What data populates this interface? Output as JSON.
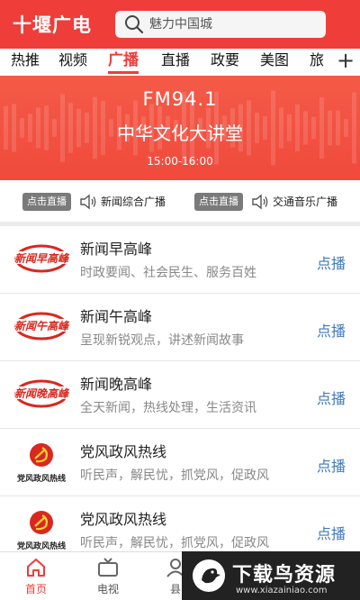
{
  "header": {
    "title": "十堰广电",
    "search_placeholder": "魅力中国城"
  },
  "nav": {
    "tabs": [
      "热推",
      "视频",
      "广播",
      "直播",
      "政要",
      "美图",
      "旅"
    ],
    "active": "广播",
    "plus": "+"
  },
  "banner": {
    "frequency": "FM94.1",
    "program": "中华文化大讲堂",
    "time": "15:00-16:00"
  },
  "live": [
    {
      "button": "点击直播",
      "station": "新闻综合广播"
    },
    {
      "button": "点击直播",
      "station": "交通音乐广播"
    }
  ],
  "programs": [
    {
      "logo": "news-peak",
      "logo_text": "新闻早高峰",
      "title": "新闻早高峰",
      "desc": "时政要闻、社会民生、服务百姓",
      "action": "点播"
    },
    {
      "logo": "news-peak",
      "logo_text": "新闻午高峰",
      "title": "新闻午高峰",
      "desc": "呈现新锐观点，讲述新闻故事",
      "action": "点播"
    },
    {
      "logo": "news-peak",
      "logo_text": "新闻晚高峰",
      "title": "新闻晚高峰",
      "desc": "全天新闻，热线处理，生活资讯",
      "action": "点播"
    },
    {
      "logo": "party-emblem",
      "logo_text": "党风政风热线",
      "title": "党风政风热线",
      "desc": "听民声，解民忧，抓党风，促政风",
      "action": "点播"
    },
    {
      "logo": "party-emblem",
      "logo_text": "党风政风热线",
      "title": "党风政风热线",
      "desc": "听民声，解民忧，抓党风，促政风",
      "action": "点播"
    }
  ],
  "bottom_nav": [
    {
      "label": "首页",
      "icon": "home-icon",
      "active": true
    },
    {
      "label": "电视",
      "icon": "tv-icon",
      "active": false
    },
    {
      "label": "县",
      "icon": "user-icon",
      "active": false
    }
  ],
  "watermark": {
    "text": "下载鸟资源",
    "url": "www.xiazainiao.com"
  },
  "colors": {
    "brand_red": "#ef3d3a",
    "link_blue": "#3f78b8",
    "live_button": "#7a7a7a"
  }
}
